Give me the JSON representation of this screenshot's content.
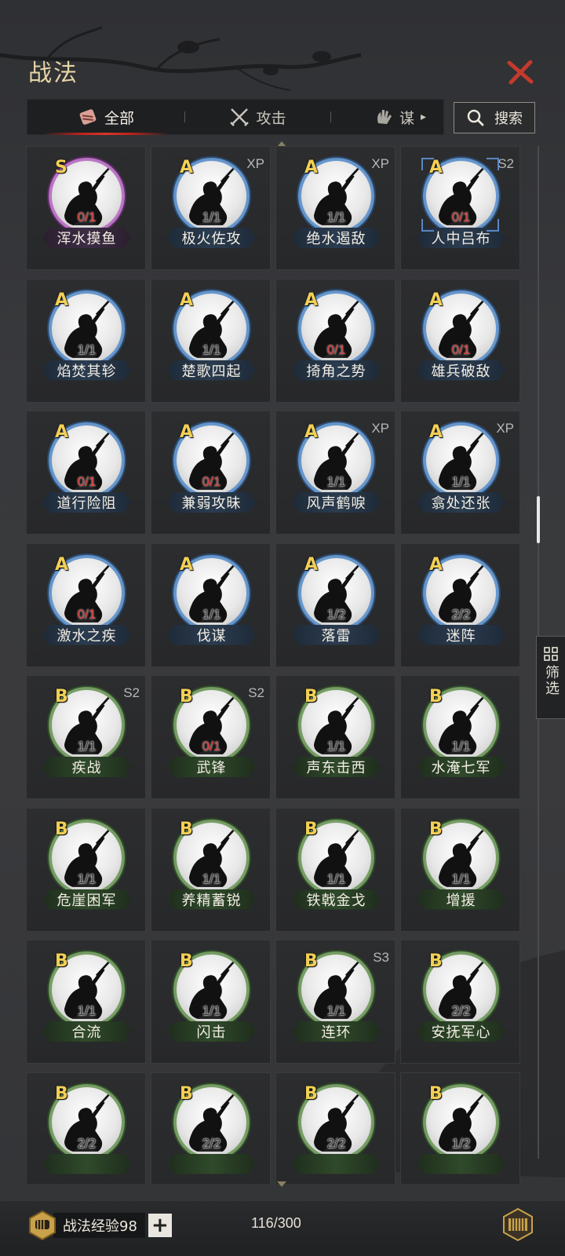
{
  "header": {
    "title": "战法"
  },
  "tabs": [
    {
      "label": "全部",
      "icon": "scroll-icon",
      "active": true
    },
    {
      "label": "攻击",
      "icon": "crossed-swords-icon",
      "active": false
    },
    {
      "label": "谋",
      "icon": "hand-icon",
      "active": false
    }
  ],
  "search": {
    "label": "搜索"
  },
  "filter": {
    "label": "筛选"
  },
  "grade_colors": {
    "S": "#c680cf",
    "A": "#6e9ed3",
    "B": "#7fa56c"
  },
  "cards": [
    {
      "grade": "S",
      "tag": "",
      "count": "0/1",
      "zero": true,
      "name": "浑水摸鱼"
    },
    {
      "grade": "A",
      "tag": "XP",
      "count": "1/1",
      "zero": false,
      "name": "极火佐攻"
    },
    {
      "grade": "A",
      "tag": "XP",
      "count": "1/1",
      "zero": false,
      "name": "绝水遏敌"
    },
    {
      "grade": "A",
      "tag": "S2",
      "count": "0/1",
      "zero": true,
      "name": "人中吕布",
      "selected": true
    },
    {
      "grade": "A",
      "tag": "",
      "count": "1/1",
      "zero": false,
      "name": "焰焚其轸"
    },
    {
      "grade": "A",
      "tag": "",
      "count": "1/1",
      "zero": false,
      "name": "楚歌四起"
    },
    {
      "grade": "A",
      "tag": "",
      "count": "0/1",
      "zero": true,
      "name": "掎角之势"
    },
    {
      "grade": "A",
      "tag": "",
      "count": "0/1",
      "zero": true,
      "name": "雄兵破敌"
    },
    {
      "grade": "A",
      "tag": "",
      "count": "0/1",
      "zero": true,
      "name": "道行险阻"
    },
    {
      "grade": "A",
      "tag": "",
      "count": "0/1",
      "zero": true,
      "name": "兼弱攻昧"
    },
    {
      "grade": "A",
      "tag": "XP",
      "count": "1/1",
      "zero": false,
      "name": "风声鹤唳"
    },
    {
      "grade": "A",
      "tag": "XP",
      "count": "1/1",
      "zero": false,
      "name": "翕处还张"
    },
    {
      "grade": "A",
      "tag": "",
      "count": "0/1",
      "zero": true,
      "name": "激水之疾"
    },
    {
      "grade": "A",
      "tag": "",
      "count": "1/1",
      "zero": false,
      "name": "伐谋"
    },
    {
      "grade": "A",
      "tag": "",
      "count": "1/2",
      "zero": false,
      "name": "落雷"
    },
    {
      "grade": "A",
      "tag": "",
      "count": "2/2",
      "zero": false,
      "name": "迷阵"
    },
    {
      "grade": "B",
      "tag": "S2",
      "count": "1/1",
      "zero": false,
      "name": "疾战"
    },
    {
      "grade": "B",
      "tag": "S2",
      "count": "0/1",
      "zero": true,
      "name": "武锋"
    },
    {
      "grade": "B",
      "tag": "",
      "count": "1/1",
      "zero": false,
      "name": "声东击西"
    },
    {
      "grade": "B",
      "tag": "",
      "count": "1/1",
      "zero": false,
      "name": "水淹七军"
    },
    {
      "grade": "B",
      "tag": "",
      "count": "1/1",
      "zero": false,
      "name": "危崖困军"
    },
    {
      "grade": "B",
      "tag": "",
      "count": "1/1",
      "zero": false,
      "name": "养精蓄锐"
    },
    {
      "grade": "B",
      "tag": "",
      "count": "1/1",
      "zero": false,
      "name": "铁戟金戈"
    },
    {
      "grade": "B",
      "tag": "",
      "count": "1/1",
      "zero": false,
      "name": "增援"
    },
    {
      "grade": "B",
      "tag": "",
      "count": "1/1",
      "zero": false,
      "name": "合流"
    },
    {
      "grade": "B",
      "tag": "",
      "count": "1/1",
      "zero": false,
      "name": "闪击"
    },
    {
      "grade": "B",
      "tag": "S3",
      "count": "1/1",
      "zero": false,
      "name": "连环"
    },
    {
      "grade": "B",
      "tag": "",
      "count": "2/2",
      "zero": false,
      "name": "安抚军心"
    },
    {
      "grade": "B",
      "tag": "",
      "count": "2/2",
      "zero": false,
      "name": ""
    },
    {
      "grade": "B",
      "tag": "",
      "count": "2/2",
      "zero": false,
      "name": ""
    },
    {
      "grade": "B",
      "tag": "",
      "count": "2/2",
      "zero": false,
      "name": ""
    },
    {
      "grade": "B",
      "tag": "",
      "count": "1/2",
      "zero": false,
      "name": ""
    }
  ],
  "footer": {
    "exp_label": "战法经验98",
    "plus_label": "+",
    "capacity": "116/300"
  }
}
